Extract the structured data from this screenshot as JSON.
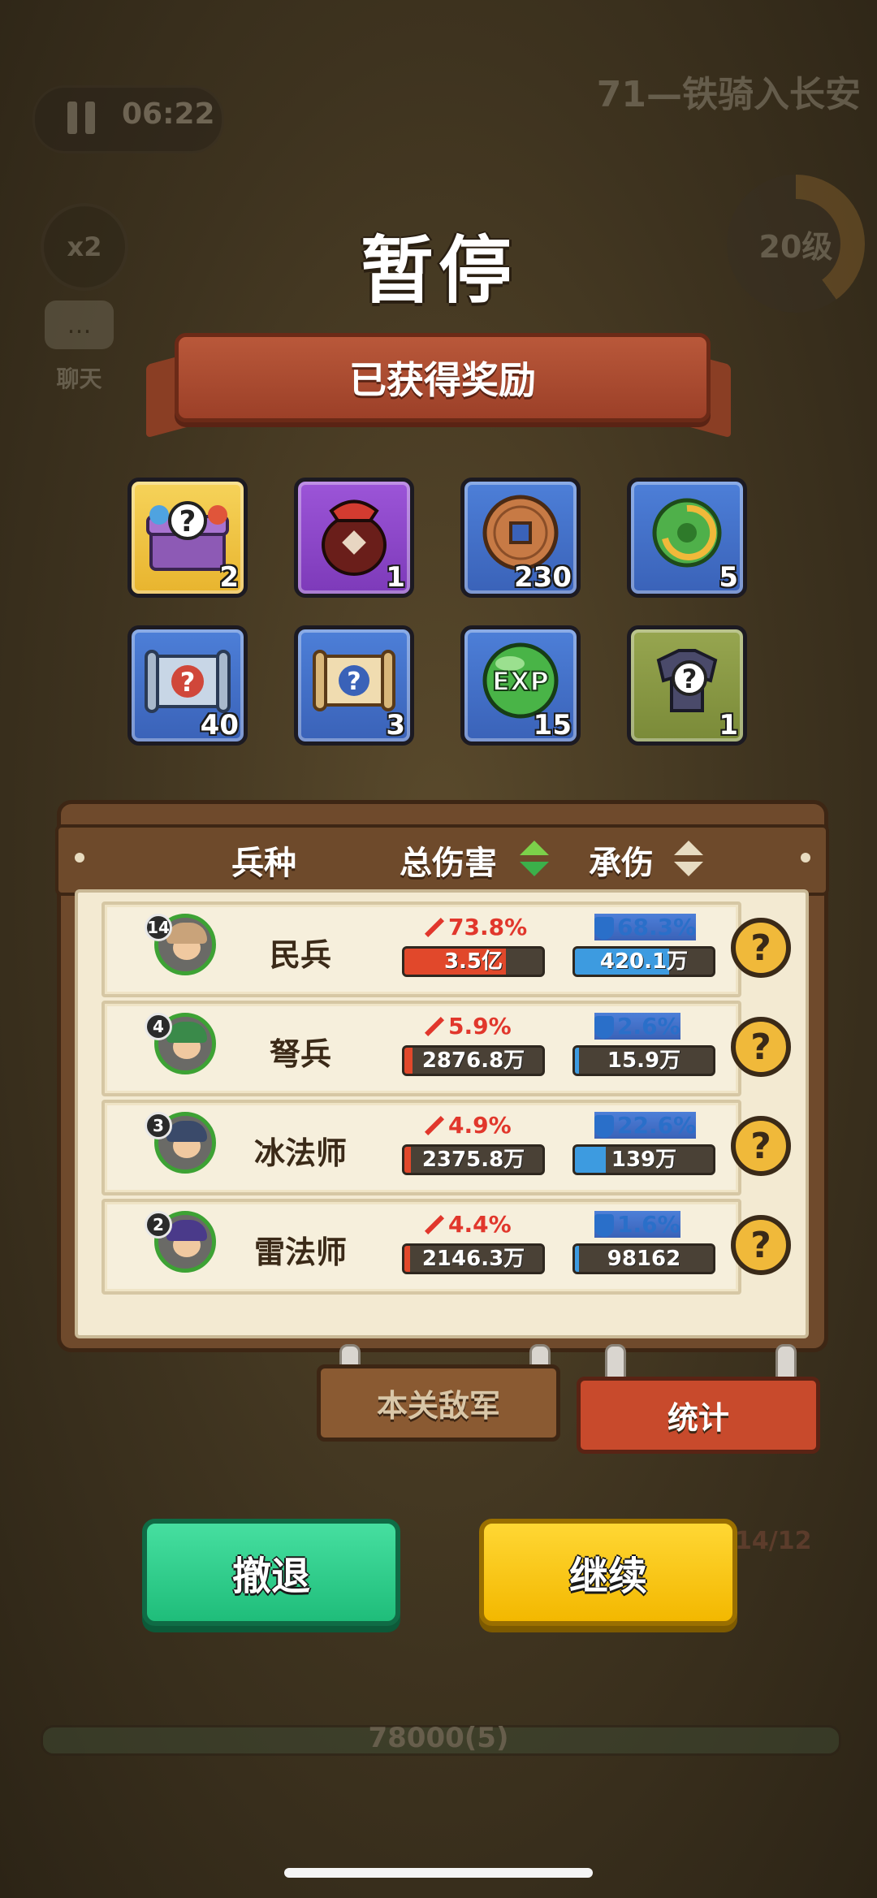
{
  "hud": {
    "timer": "06:22",
    "speed": "x2",
    "chat_label": "聊天",
    "stage_title": "71—铁骑入长安",
    "level": "20级",
    "enemy_count": "14/12",
    "hp_text": "78000(5)"
  },
  "dialog": {
    "title": "暂停",
    "rewards_banner": "已获得奖励",
    "rewards": [
      {
        "icon": "mystery-chest-icon",
        "count": "2",
        "bg": "gold"
      },
      {
        "icon": "wine-jar-icon",
        "count": "1",
        "bg": "purple"
      },
      {
        "icon": "copper-coin-icon",
        "count": "230",
        "bg": "blue"
      },
      {
        "icon": "jade-pendant-icon",
        "count": "5",
        "bg": "blue"
      },
      {
        "icon": "mystery-scroll-blue-icon",
        "count": "40",
        "bg": "blue"
      },
      {
        "icon": "mystery-scroll-icon",
        "count": "3",
        "bg": "blue"
      },
      {
        "icon": "exp-orb-icon",
        "count": "15",
        "bg": "blue",
        "label": "EXP"
      },
      {
        "icon": "mystery-armor-icon",
        "count": "1",
        "bg": "olive"
      }
    ],
    "stats": {
      "col_unit": "兵种",
      "col_damage": "总伤害",
      "col_taken": "承伤",
      "rows": [
        {
          "level": "14",
          "name": "民兵",
          "dmg_pct": "73.8%",
          "dmg_val": "3.5亿",
          "dmg_fill": 0.738,
          "taken_pct": "68.3%",
          "taken_val": "420.1万",
          "taken_fill": 0.683
        },
        {
          "level": "4",
          "name": "弩兵",
          "dmg_pct": "5.9%",
          "dmg_val": "2876.8万",
          "dmg_fill": 0.059,
          "taken_pct": "2.6%",
          "taken_val": "15.9万",
          "taken_fill": 0.026
        },
        {
          "level": "3",
          "name": "冰法师",
          "dmg_pct": "4.9%",
          "dmg_val": "2375.8万",
          "dmg_fill": 0.049,
          "taken_pct": "22.6%",
          "taken_val": "139万",
          "taken_fill": 0.226
        },
        {
          "level": "2",
          "name": "雷法师",
          "dmg_pct": "4.4%",
          "dmg_val": "2146.3万",
          "dmg_fill": 0.044,
          "taken_pct": "1.6%",
          "taken_val": "98162",
          "taken_fill": 0.016
        }
      ]
    },
    "tabs": {
      "enemies": "本关敌军",
      "stats": "统计"
    },
    "buttons": {
      "retreat": "撤退",
      "continue": "继续"
    }
  },
  "colors": {
    "damage": "#e1372c",
    "taken": "#2a6fc9",
    "retreat": "#1fbd7a",
    "continue": "#f3b800"
  }
}
